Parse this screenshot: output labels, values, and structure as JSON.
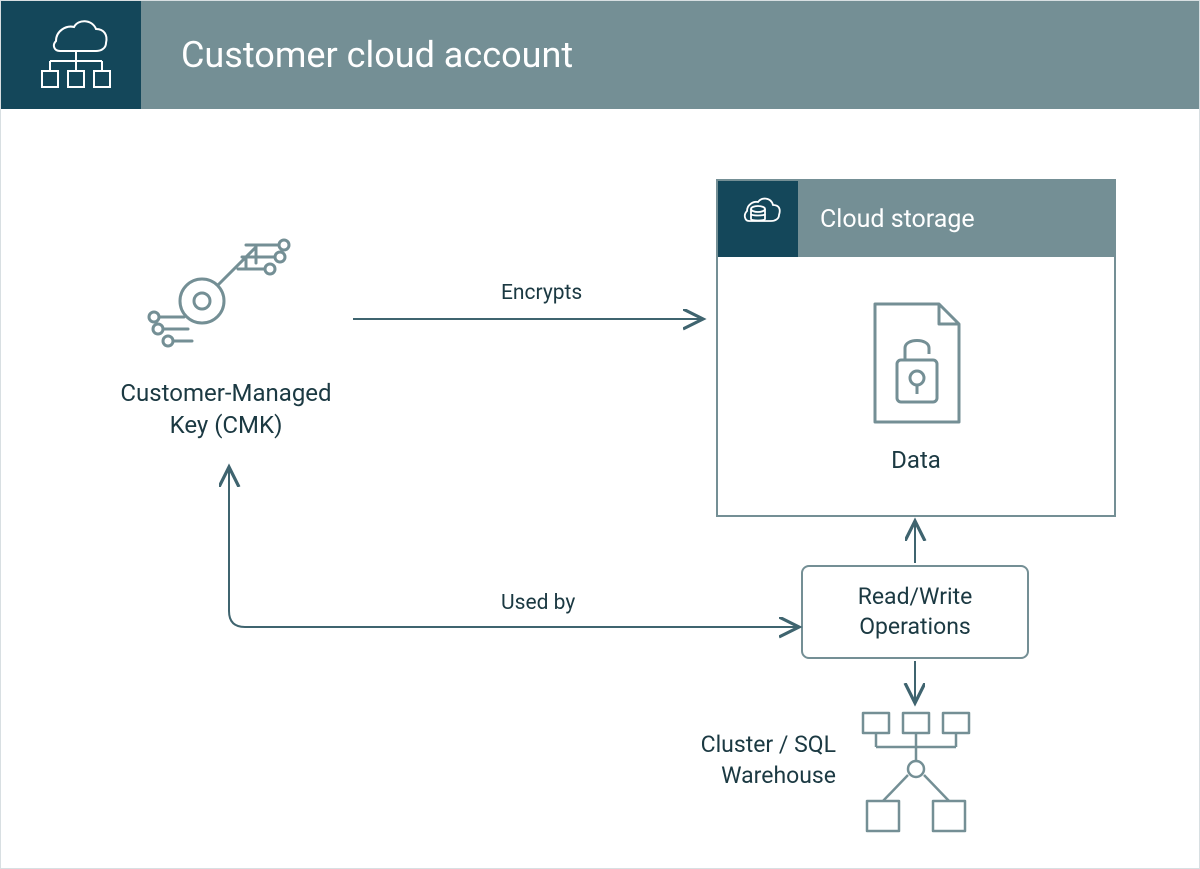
{
  "header": {
    "title": "Customer cloud account"
  },
  "nodes": {
    "cmk": {
      "label": "Customer-Managed Key (CMK)"
    },
    "cloud_storage": {
      "title": "Cloud storage",
      "data_label": "Data"
    },
    "rw_ops": {
      "label": "Read/Write Operations"
    },
    "cluster": {
      "label": "Cluster / SQL Warehouse"
    }
  },
  "edges": {
    "encrypts": {
      "label": "Encrypts"
    },
    "used_by": {
      "label": "Used by"
    }
  },
  "colors": {
    "dark_teal": "#14475a",
    "mid_teal": "#748f95",
    "text": "#1b3942",
    "stroke": "#3f646f"
  }
}
